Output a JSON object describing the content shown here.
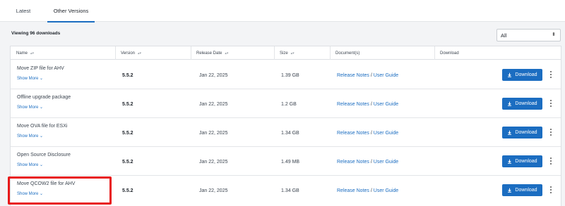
{
  "tabs": [
    {
      "label": "Latest"
    },
    {
      "label": "Other Versions"
    }
  ],
  "viewing_text": "Viewing 96 downloads",
  "filter": {
    "value": "All"
  },
  "table": {
    "headers": [
      "Name",
      "Version",
      "Release Date",
      "Size",
      "Document(s)",
      "Download"
    ],
    "rows": [
      {
        "name": "Move ZIP file for AHV",
        "show_more": "Show More",
        "version": "5.5.2",
        "date": "Jan 22, 2025",
        "size": "1.39 GB",
        "release_notes": "Release Notes",
        "sep": " / ",
        "user_guide": "User Guide",
        "download": "Download"
      },
      {
        "name": "Offline upgrade package",
        "show_more": "Show More",
        "version": "5.5.2",
        "date": "Jan 22, 2025",
        "size": "1.2 GB",
        "release_notes": "Release Notes",
        "sep": " / ",
        "user_guide": "User Guide",
        "download": "Download"
      },
      {
        "name": "Move OVA file for ESXi",
        "show_more": "Show More",
        "version": "5.5.2",
        "date": "Jan 22, 2025",
        "size": "1.34 GB",
        "release_notes": "Release Notes",
        "sep": " / ",
        "user_guide": "User Guide",
        "download": "Download"
      },
      {
        "name": "Open Source Disclosure",
        "show_more": "Show More",
        "version": "5.5.2",
        "date": "Jan 22, 2025",
        "size": "1.49 MB",
        "release_notes": "Release Notes",
        "sep": " / ",
        "user_guide": "User Guide",
        "download": "Download"
      },
      {
        "name": "Move QCOW2 file for AHV",
        "show_more": "Show More",
        "version": "5.5.2",
        "date": "Jan 22, 2025",
        "size": "1.34 GB",
        "release_notes": "Release Notes",
        "sep": " / ",
        "user_guide": "User Guide",
        "download": "Download"
      }
    ]
  },
  "colors": {
    "accent": "#1b6dc1",
    "highlight": "#e8191a"
  },
  "icons": {
    "sort": "sort-icon",
    "chevron": "chevron-down-icon",
    "download": "download-icon",
    "kebab": "kebab-menu-icon"
  }
}
